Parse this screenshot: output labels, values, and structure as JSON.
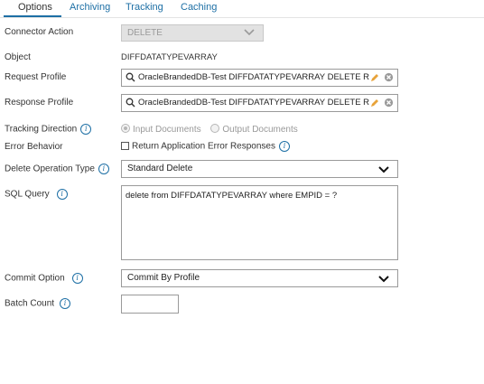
{
  "tabs": [
    "Options",
    "Archiving",
    "Tracking",
    "Caching"
  ],
  "labels": {
    "connector_action": "Connector Action",
    "object": "Object",
    "request_profile": "Request Profile",
    "response_profile": "Response Profile",
    "tracking_direction": "Tracking Direction",
    "error_behavior": "Error Behavior",
    "delete_operation_type": "Delete Operation Type",
    "sql_query": "SQL Query",
    "commit_option": "Commit Option",
    "batch_count": "Batch Count"
  },
  "connector_action": "DELETE",
  "object": "DIFFDATATYPEVARRAY",
  "request_profile": "OracleBrandedDB-Test DIFFDATATYPEVARRAY DELETE Request",
  "response_profile": "OracleBrandedDB-Test DIFFDATATYPEVARRAY DELETE Response",
  "tracking": {
    "input": "Input Documents",
    "output": "Output Documents",
    "selected": "input"
  },
  "error_behavior": {
    "label": "Return Application Error Responses",
    "checked": false
  },
  "delete_operation_type": "Standard Delete",
  "sql_query": "delete from DIFFDATATYPEVARRAY where EMPID = ?",
  "commit_option": "Commit By Profile",
  "batch_count": "",
  "icons": {
    "info": "info-icon",
    "search": "search-icon",
    "edit": "pencil-icon",
    "clear": "clear-icon",
    "chevron": "chevron-down-icon"
  },
  "colors": {
    "accent": "#1d6fa5",
    "edit": "#e8a33a",
    "disabled_bg": "#e2e2e2"
  }
}
